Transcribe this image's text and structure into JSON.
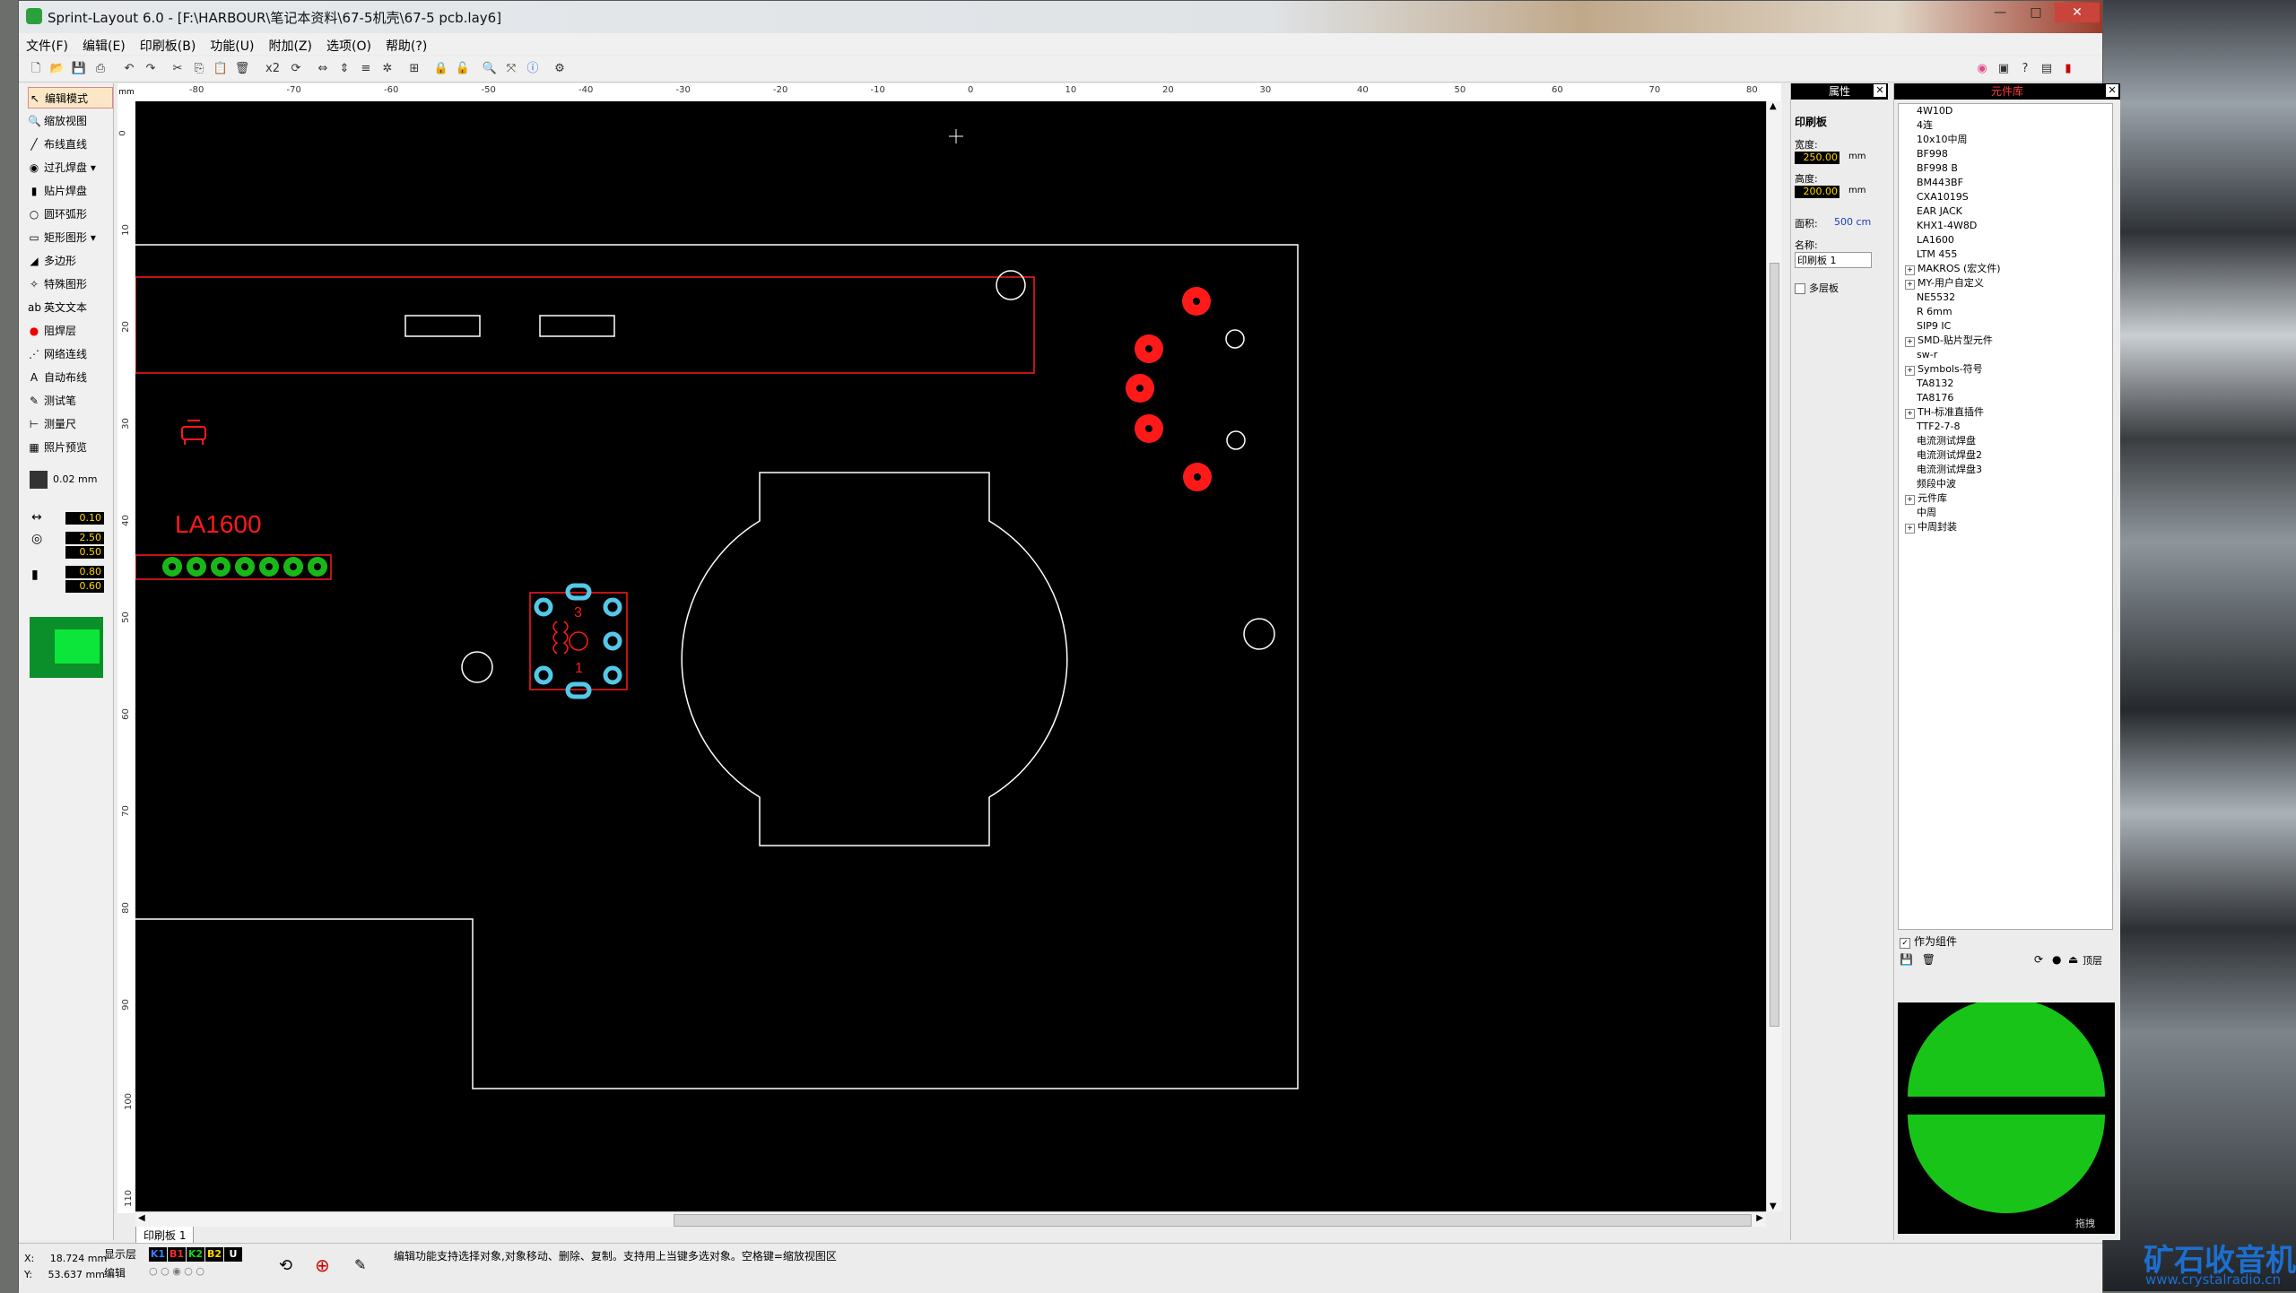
{
  "window": {
    "title": "Sprint-Layout 6.0 - [F:\\HARBOUR\\笔记本资料\\67-5机壳\\67-5 pcb.lay6]",
    "controls": {
      "minimize": "—",
      "maximize": "□",
      "close": "✕"
    }
  },
  "menu": [
    "文件(F)",
    "编辑(E)",
    "印刷板(B)",
    "功能(U)",
    "附加(Z)",
    "选项(O)",
    "帮助(?)"
  ],
  "toolbar": {
    "x2_label": "x2"
  },
  "tools": [
    {
      "label": "编辑模式",
      "icon": "pointer-icon",
      "glyph": "↖",
      "active": true
    },
    {
      "label": "缩放视图",
      "icon": "zoom-icon",
      "glyph": "🔍"
    },
    {
      "label": "布线直线",
      "icon": "track-icon",
      "glyph": "╱"
    },
    {
      "label": "过孔焊盘",
      "icon": "via-icon",
      "glyph": "◉",
      "dropdown": true
    },
    {
      "label": "贴片焊盘",
      "icon": "smd-pad-icon",
      "glyph": "▮"
    },
    {
      "label": "圆环弧形",
      "icon": "circle-icon",
      "glyph": "○"
    },
    {
      "label": "矩形图形",
      "icon": "rectangle-icon",
      "glyph": "▭",
      "dropdown": true
    },
    {
      "label": "多边形",
      "icon": "polygon-icon",
      "glyph": "◢"
    },
    {
      "label": "特殊图形",
      "icon": "special-shape-icon",
      "glyph": "✧"
    },
    {
      "label": "英文文本",
      "icon": "text-icon",
      "glyph": "ab"
    },
    {
      "label": "阻焊层",
      "icon": "solder-mask-icon",
      "glyph": "●"
    },
    {
      "label": "网络连线",
      "icon": "netlist-icon",
      "glyph": "⋰"
    },
    {
      "label": "自动布线",
      "icon": "autoroute-icon",
      "glyph": "A"
    },
    {
      "label": "测试笔",
      "icon": "test-probe-icon",
      "glyph": "✎"
    },
    {
      "label": "测量尺",
      "icon": "ruler-icon",
      "glyph": "⊢"
    },
    {
      "label": "照片预览",
      "icon": "photo-view-icon",
      "glyph": "▦"
    }
  ],
  "grid": {
    "size": "0.02 mm"
  },
  "params": {
    "track_width": "0.10",
    "pad_outer": "2.50",
    "pad_inner": "0.50",
    "smd_w": "0.80",
    "smd_h": "0.60"
  },
  "ruler": {
    "unit": "mm",
    "top_labels": [
      "-80",
      "-70",
      "-60",
      "-50",
      "-40",
      "-30",
      "-20",
      "-10",
      "0",
      "10",
      "20",
      "30",
      "40",
      "50",
      "60",
      "70",
      "80"
    ],
    "left_labels": [
      "0",
      "10",
      "20",
      "30",
      "40",
      "50",
      "60",
      "70",
      "80",
      "90",
      "100",
      "110"
    ]
  },
  "canvas": {
    "component_label": "LA1600",
    "pin_labels": [
      "3",
      "1"
    ]
  },
  "tab": {
    "label": "印刷板 1"
  },
  "properties": {
    "header": "属性",
    "section": "印刷板",
    "width_label": "宽度:",
    "width_value": "250.00",
    "height_label": "高度:",
    "height_value": "200.00",
    "unit": "mm",
    "area_label": "面积:",
    "area_value": "500 cm",
    "name_label": "名称:",
    "name_value": "印刷板 1",
    "multilayer_label": "多层板"
  },
  "library": {
    "header": "元件库",
    "items": [
      {
        "text": "4W10D",
        "type": "leaf"
      },
      {
        "text": "4连",
        "type": "leaf"
      },
      {
        "text": "10x10中周",
        "type": "leaf"
      },
      {
        "text": "BF998",
        "type": "leaf"
      },
      {
        "text": "BF998 B",
        "type": "leaf"
      },
      {
        "text": "BM443BF",
        "type": "leaf"
      },
      {
        "text": "CXA1019S",
        "type": "leaf"
      },
      {
        "text": "EAR JACK",
        "type": "leaf"
      },
      {
        "text": "KHX1-4W8D",
        "type": "leaf"
      },
      {
        "text": "LA1600",
        "type": "leaf"
      },
      {
        "text": "LTM 455",
        "type": "leaf"
      },
      {
        "text": "MAKROS (宏文件)",
        "type": "node"
      },
      {
        "text": "MY-用户自定义",
        "type": "node"
      },
      {
        "text": "NE5532",
        "type": "leaf"
      },
      {
        "text": "R 6mm",
        "type": "leaf"
      },
      {
        "text": "SIP9 IC",
        "type": "leaf"
      },
      {
        "text": "SMD-贴片型元件",
        "type": "node"
      },
      {
        "text": "sw-r",
        "type": "leaf"
      },
      {
        "text": "Symbols-符号",
        "type": "node"
      },
      {
        "text": "TA8132",
        "type": "leaf"
      },
      {
        "text": "TA8176",
        "type": "leaf"
      },
      {
        "text": "TH-标准直插件",
        "type": "node"
      },
      {
        "text": "TTF2-7-8",
        "type": "leaf"
      },
      {
        "text": "电流测试焊盘",
        "type": "leaf"
      },
      {
        "text": "电流测试焊盘2",
        "type": "leaf"
      },
      {
        "text": "电流测试焊盘3",
        "type": "leaf"
      },
      {
        "text": "频段中波",
        "type": "leaf"
      },
      {
        "text": "元件库",
        "type": "node"
      },
      {
        "text": "中周",
        "type": "leaf"
      },
      {
        "text": "中周封装",
        "type": "node"
      }
    ],
    "as_component_label": "作为组件",
    "top_layer_label": "顶层",
    "preview_label": "拖拽"
  },
  "status": {
    "x_label": "X:",
    "x_value": "18.724 mm",
    "y_label": "Y:",
    "y_value": "53.637 mm",
    "visible_layers_label": "显示层",
    "edit_label": "编辑",
    "layers": [
      {
        "name": "K1",
        "color": "#3d7bff"
      },
      {
        "name": "B1",
        "color": "#ff2a2a"
      },
      {
        "name": "K2",
        "color": "#19d219"
      },
      {
        "name": "B2",
        "color": "#ffd600"
      },
      {
        "name": "U",
        "color": "#ffffff"
      }
    ],
    "message": "编辑功能支持选择对象,对象移动、删除、复制。支持用上当键多选对象。空格键=缩放视图区"
  },
  "desktop": {
    "logo": "矿石收音机",
    "url": "www.crystalradio.cn"
  },
  "colors": {
    "copper_top": "#ff1a1a",
    "silkscreen": "#ffffff",
    "pad_green": "#19b819",
    "pad_cyan": "#54c8e8",
    "board_outline": "#ffffff"
  }
}
